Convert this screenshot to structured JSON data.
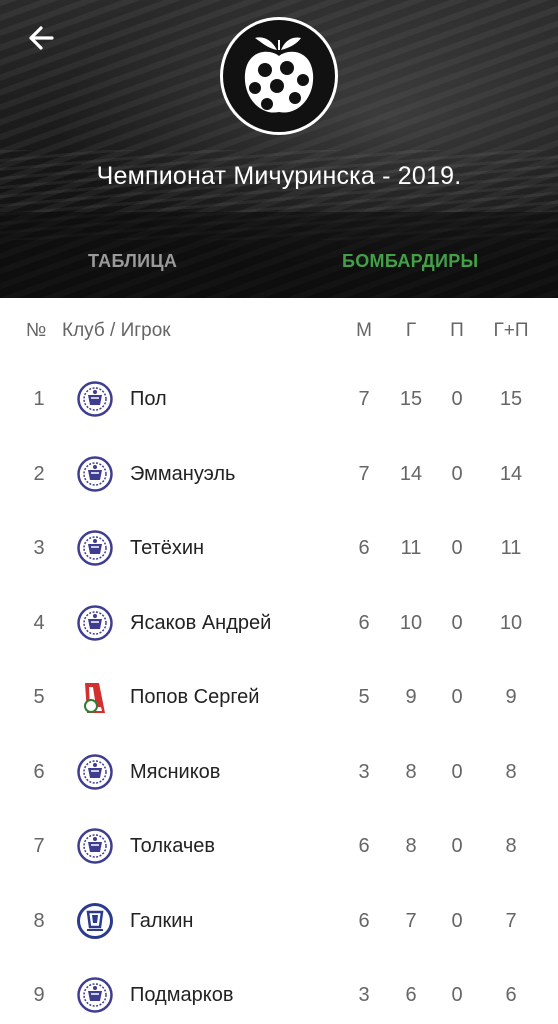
{
  "header": {
    "title": "Чемпионат Мичуринска - 2019.",
    "logo_icon": "apple-football-logo-icon",
    "back_icon": "arrow-left-icon"
  },
  "tabs": [
    {
      "label": "ТАБЛИЦА",
      "active": false
    },
    {
      "label": "БОМБАРДИРЫ",
      "active": true
    }
  ],
  "colors": {
    "accent": "#43a047",
    "crest_blue": "#3f3d8f",
    "crest_red": "#d32f2f"
  },
  "columns": {
    "num": "№",
    "club_player": "Клуб / Игрок",
    "m": "М",
    "g": "Г",
    "p": "П",
    "gp": "Г+П"
  },
  "rows": [
    {
      "num": "1",
      "player": "Пол",
      "crest": "club-crest-icon",
      "m": "7",
      "g": "15",
      "p": "0",
      "gp": "15"
    },
    {
      "num": "2",
      "player": "Эммануэль",
      "crest": "club-crest-icon",
      "m": "7",
      "g": "14",
      "p": "0",
      "gp": "14"
    },
    {
      "num": "3",
      "player": "Тетёхин",
      "crest": "club-crest-icon",
      "m": "6",
      "g": "11",
      "p": "0",
      "gp": "11"
    },
    {
      "num": "4",
      "player": "Ясаков Андрей",
      "crest": "club-crest-icon",
      "m": "6",
      "g": "10",
      "p": "0",
      "gp": "10"
    },
    {
      "num": "5",
      "player": "Попов Сергей",
      "crest": "lokomotiv-crest-icon",
      "m": "5",
      "g": "9",
      "p": "0",
      "gp": "9"
    },
    {
      "num": "6",
      "player": "Мясников",
      "crest": "club-crest-icon",
      "m": "3",
      "g": "8",
      "p": "0",
      "gp": "8"
    },
    {
      "num": "7",
      "player": "Толкачев",
      "crest": "club-crest-icon",
      "m": "6",
      "g": "8",
      "p": "0",
      "gp": "8"
    },
    {
      "num": "8",
      "player": "Галкин",
      "crest": "dynamo-crest-icon",
      "m": "6",
      "g": "7",
      "p": "0",
      "gp": "7"
    },
    {
      "num": "9",
      "player": "Подмарков",
      "crest": "club-crest-icon",
      "m": "3",
      "g": "6",
      "p": "0",
      "gp": "6"
    }
  ]
}
